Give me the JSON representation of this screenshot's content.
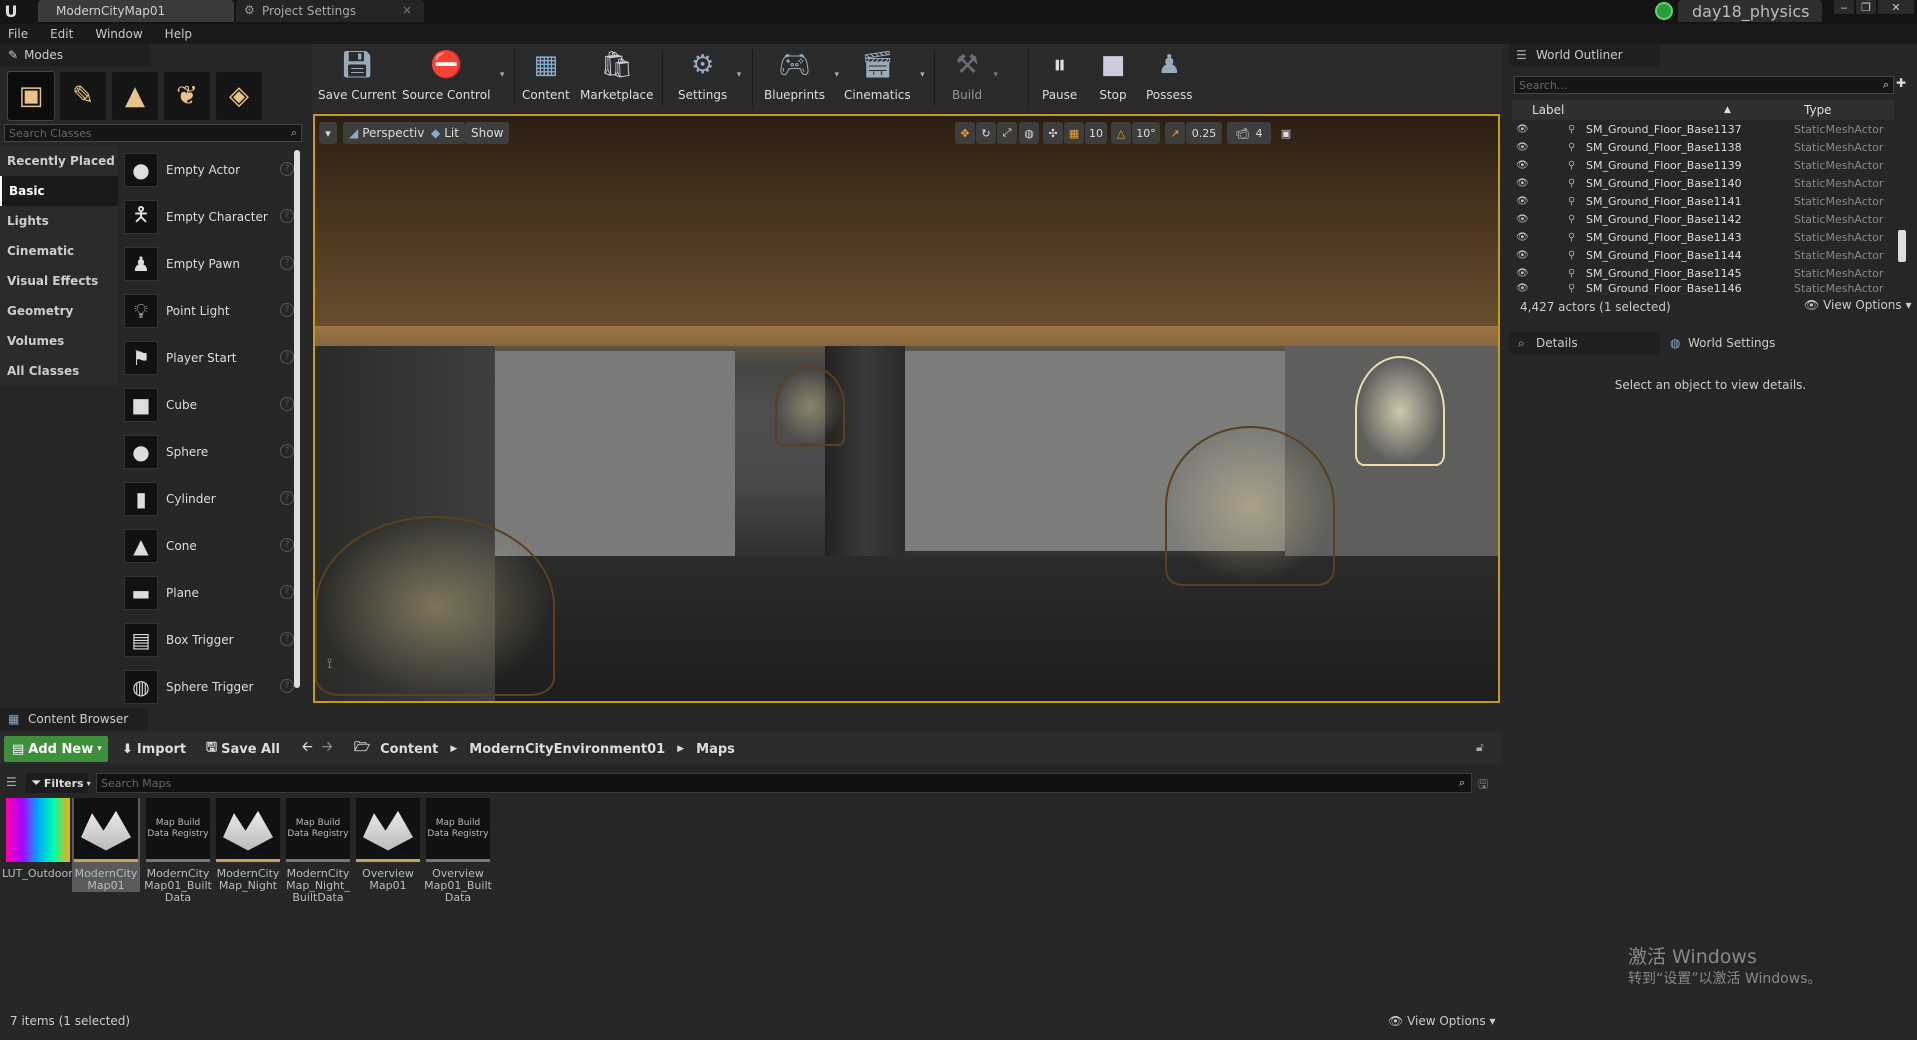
{
  "titlebar": {
    "tab_active": "ModernCityMap01",
    "tab_second": "Project Settings",
    "project_name": "day18_physics"
  },
  "menu": [
    "File",
    "Edit",
    "Window",
    "Help"
  ],
  "modes": {
    "title": "Modes",
    "search_placeholder": "Search Classes",
    "categories": [
      "Recently Placed",
      "Basic",
      "Lights",
      "Cinematic",
      "Visual Effects",
      "Geometry",
      "Volumes",
      "All Classes"
    ],
    "selected_category": "Basic",
    "items": [
      "Empty Actor",
      "Empty Character",
      "Empty Pawn",
      "Point Light",
      "Player Start",
      "Cube",
      "Sphere",
      "Cylinder",
      "Cone",
      "Plane",
      "Box Trigger",
      "Sphere Trigger"
    ]
  },
  "toolbar": {
    "buttons": [
      "Save Current",
      "Source Control",
      "Content",
      "Marketplace",
      "Settings",
      "Blueprints",
      "Cinematics",
      "Build",
      "Pause",
      "Stop",
      "Possess"
    ]
  },
  "viewport": {
    "perspective": "Perspective",
    "lit": "Lit",
    "show": "Show",
    "grid_snap": "10",
    "rot_snap": "10°",
    "scale_snap": "0.25",
    "cam_speed": "4"
  },
  "outliner": {
    "title": "World Outliner",
    "search_placeholder": "Search...",
    "col_label": "Label",
    "col_type": "Type",
    "rows": [
      {
        "label": "SM_Ground_Floor_Base1137",
        "type": "StaticMeshActor"
      },
      {
        "label": "SM_Ground_Floor_Base1138",
        "type": "StaticMeshActor"
      },
      {
        "label": "SM_Ground_Floor_Base1139",
        "type": "StaticMeshActor"
      },
      {
        "label": "SM_Ground_Floor_Base1140",
        "type": "StaticMeshActor"
      },
      {
        "label": "SM_Ground_Floor_Base1141",
        "type": "StaticMeshActor"
      },
      {
        "label": "SM_Ground_Floor_Base1142",
        "type": "StaticMeshActor"
      },
      {
        "label": "SM_Ground_Floor_Base1143",
        "type": "StaticMeshActor"
      },
      {
        "label": "SM_Ground_Floor_Base1144",
        "type": "StaticMeshActor"
      },
      {
        "label": "SM_Ground_Floor_Base1145",
        "type": "StaticMeshActor"
      },
      {
        "label": "SM_Ground_Floor_Base1146",
        "type": "StaticMeshActor"
      }
    ],
    "status": "4,427 actors (1 selected)",
    "view_options": "View Options"
  },
  "details": {
    "title": "Details",
    "world_settings": "World Settings",
    "message": "Select an object to view details."
  },
  "watermark": {
    "line1": "激活 Windows",
    "line2": "转到“设置”以激活 Windows。"
  },
  "content_browser": {
    "title": "Content Browser",
    "add_new": "Add New",
    "import": "Import",
    "save_all": "Save All",
    "path": [
      "Content",
      "ModernCityEnvironment01",
      "Maps"
    ],
    "filters": "Filters",
    "search_placeholder": "Search Maps",
    "registry_thumb": "Map Build Data Registry",
    "assets": [
      {
        "name": "LUT_Outdoor_Night",
        "kind": "lut"
      },
      {
        "name": "ModernCity Map01",
        "kind": "map"
      },
      {
        "name": "ModernCity Map01_Built Data",
        "kind": "registry"
      },
      {
        "name": "ModernCity Map_Night",
        "kind": "map"
      },
      {
        "name": "ModernCity Map_Night_ BuiltData",
        "kind": "registry"
      },
      {
        "name": "Overview Map01",
        "kind": "map"
      },
      {
        "name": "Overview Map01_Built Data",
        "kind": "registry"
      }
    ],
    "selected_asset": "ModernCity Map01",
    "status": "7 items (1 selected)",
    "view_options": "View Options"
  },
  "colors": {
    "accent": "#c49a25",
    "add_new": "#3d8f3b",
    "project_icon": "#2c9b3a"
  }
}
